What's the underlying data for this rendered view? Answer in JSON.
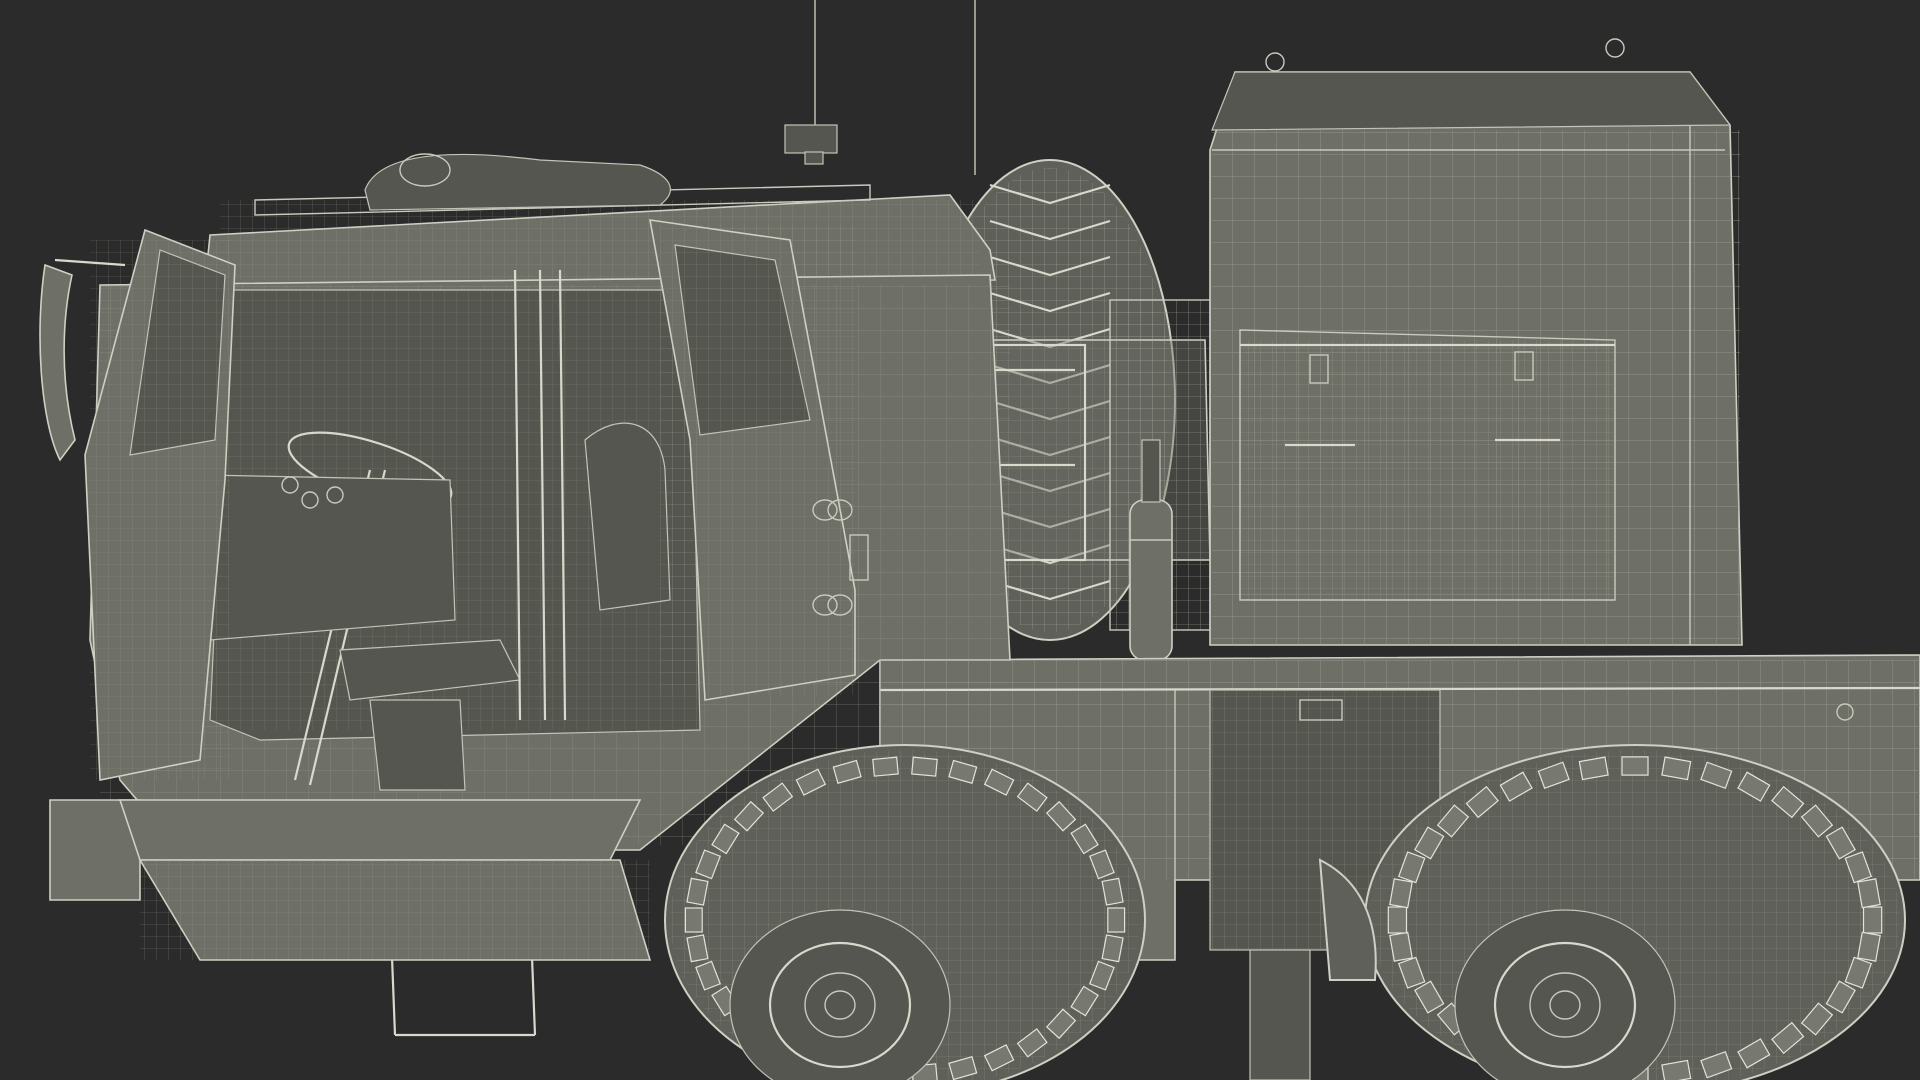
{
  "colors": {
    "background": "#2b2b2b",
    "model_fill": "#6e6f67",
    "model_shadow": "#55564f",
    "wire": "#c9cabd",
    "tire": "#5f605a"
  }
}
